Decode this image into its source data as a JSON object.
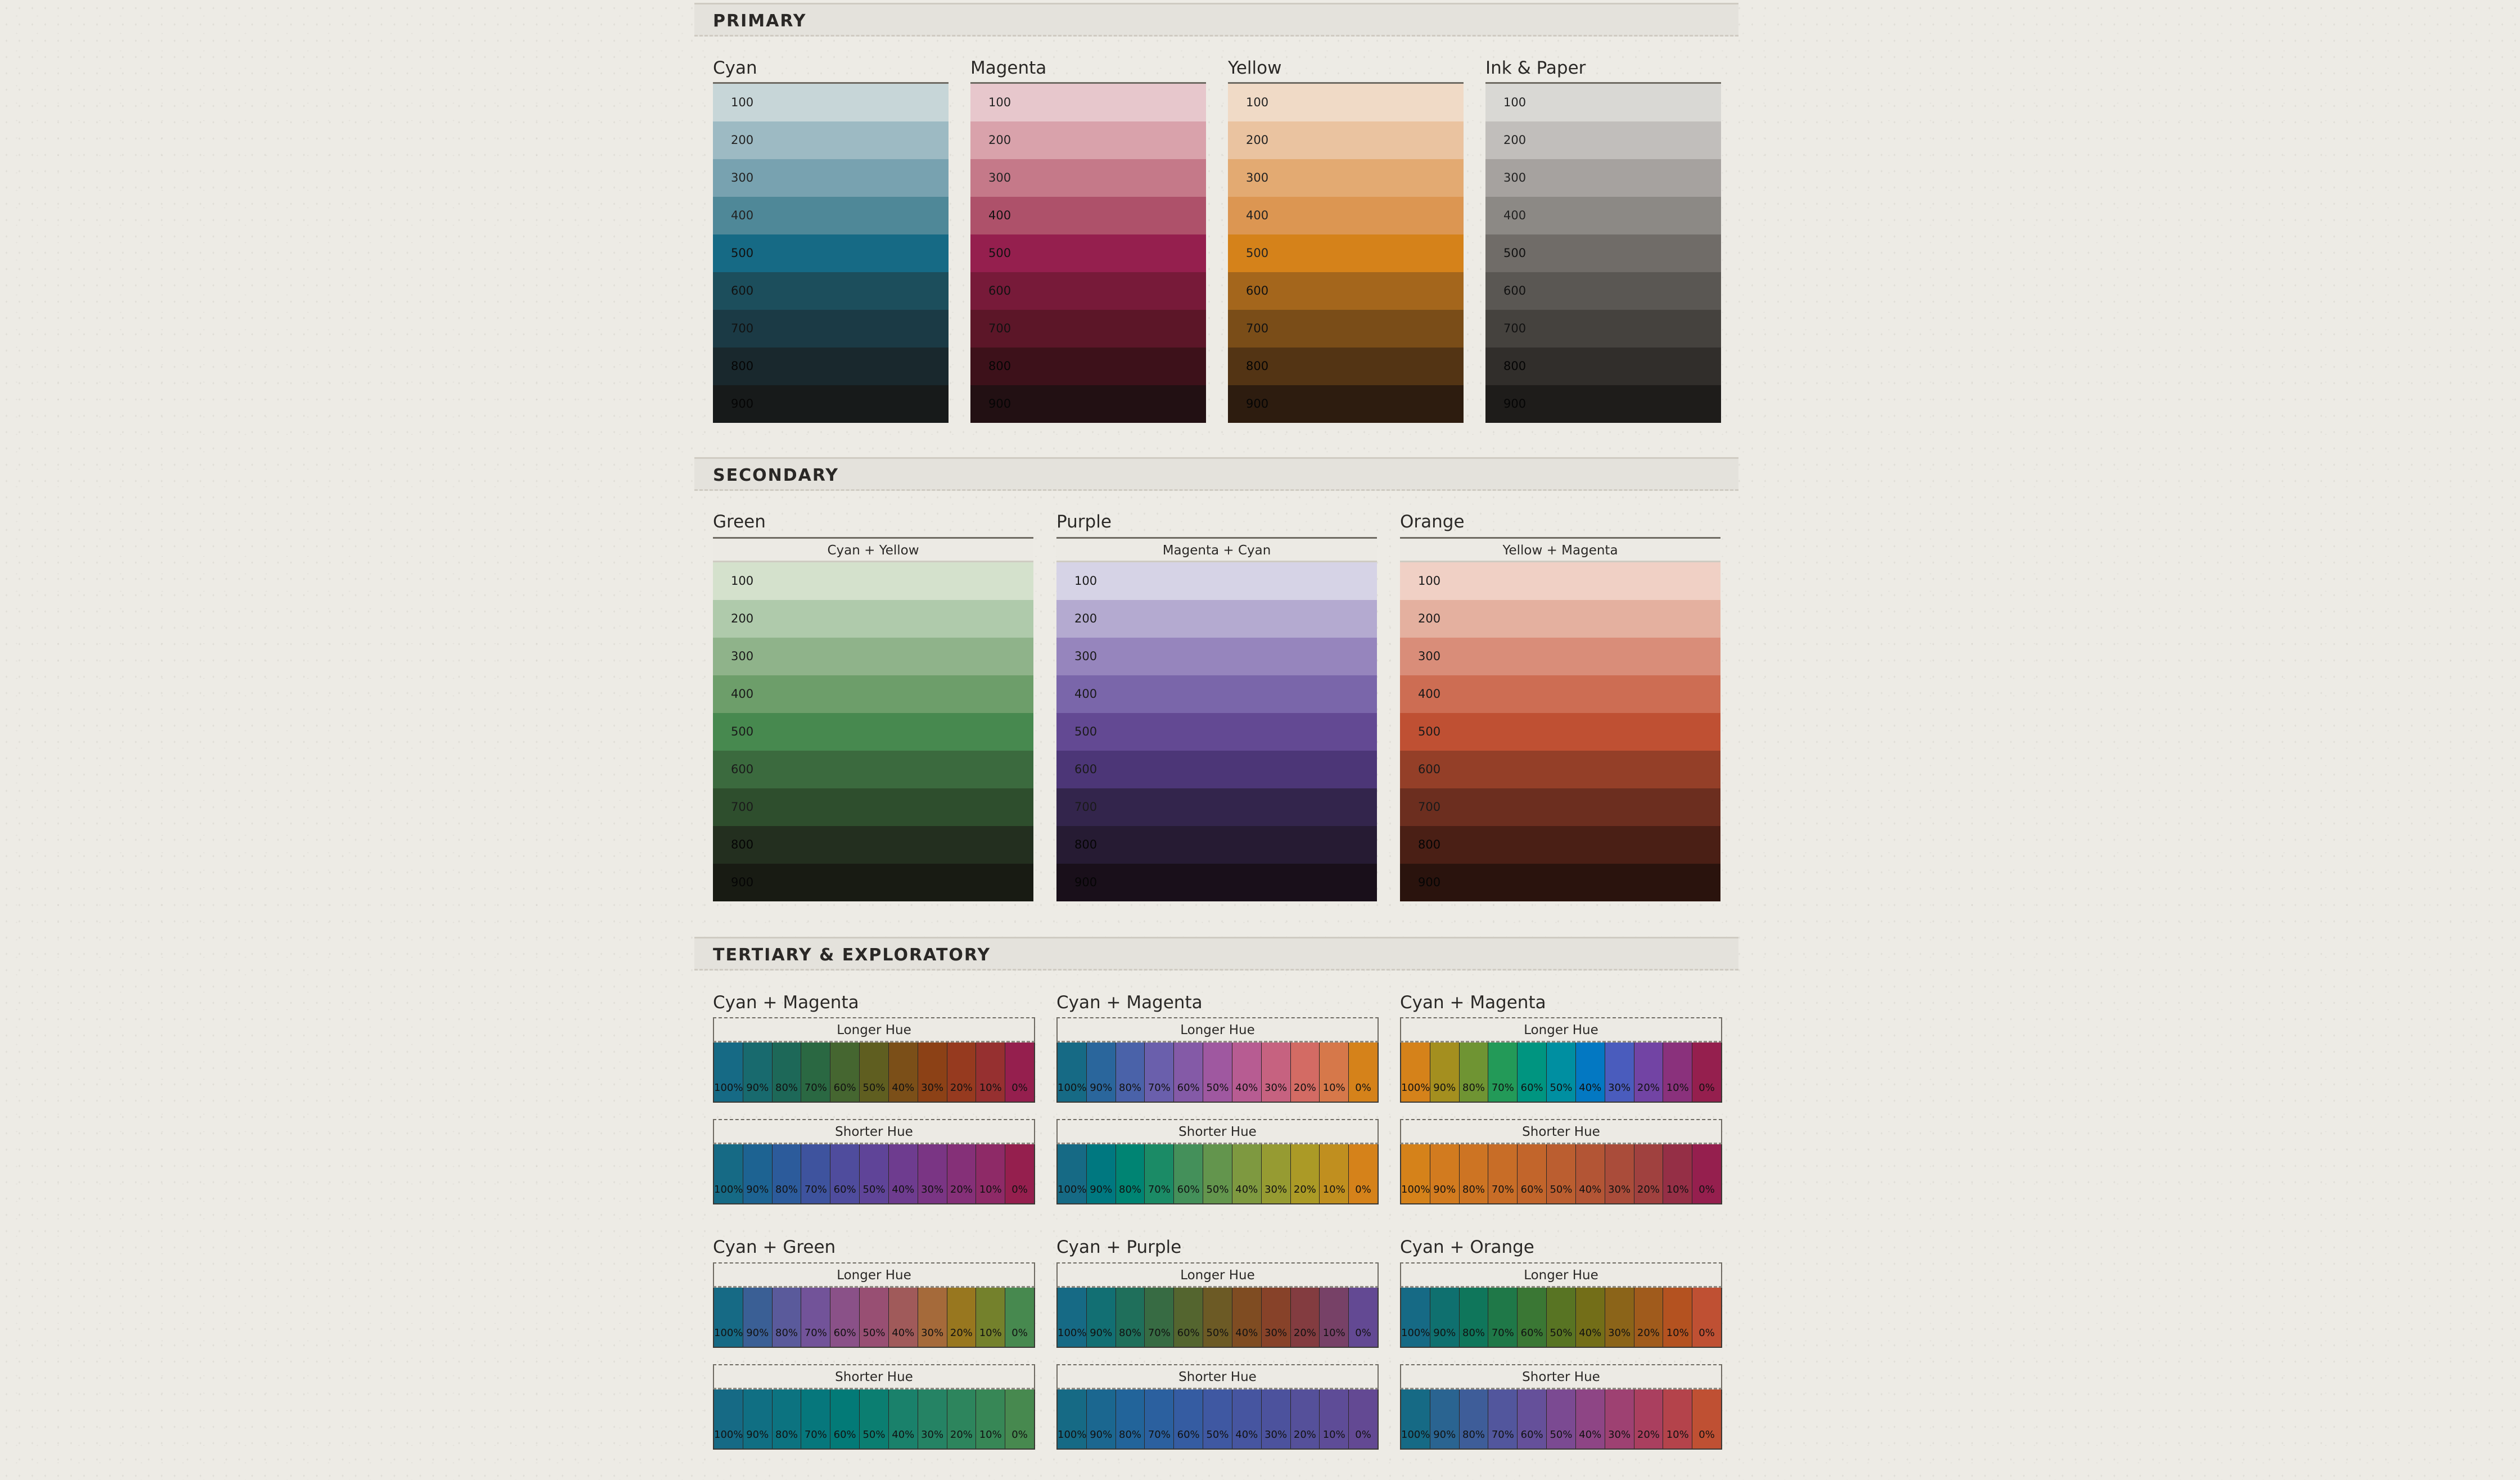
{
  "sections": {
    "primary": "PRIMARY",
    "secondary": "SECONDARY",
    "tertiary": "TERTIARY & EXPLORATORY"
  },
  "steps": [
    "100",
    "200",
    "300",
    "400",
    "500",
    "600",
    "700",
    "800",
    "900"
  ],
  "primary": [
    {
      "name": "Cyan",
      "colors": [
        "#c7d6d8",
        "#9dbac3",
        "#78a2b0",
        "#4f8898",
        "#166a85",
        "#1c4e5c",
        "#1b3a45",
        "#19282d",
        "#171a1a"
      ]
    },
    {
      "name": "Magenta",
      "colors": [
        "#e7c7cc",
        "#d9a2ab",
        "#c57989",
        "#ae516a",
        "#951f4e",
        "#771a39",
        "#5c1628",
        "#3d111a",
        "#221013"
      ]
    },
    {
      "name": "Yellow",
      "colors": [
        "#f0dac6",
        "#eac3a0",
        "#e3aa72",
        "#dc9652",
        "#d5821a",
        "#a4661c",
        "#7a4d18",
        "#533414",
        "#2d1c0f"
      ]
    },
    {
      "name": "Ink & Paper",
      "colors": [
        "#d9d8d4",
        "#c1bebb",
        "#a6a29f",
        "#8c8985",
        "#706c68",
        "#5a5753",
        "#45423e",
        "#312e2b",
        "#1e1c1a"
      ]
    }
  ],
  "secondary": [
    {
      "name": "Green",
      "mix": "Cyan + Yellow",
      "colors": [
        "#d4e1cc",
        "#afcaab",
        "#8fb38a",
        "#6d9e6a",
        "#47894f",
        "#3b6a3e",
        "#2e4e2d",
        "#232f1f",
        "#181b13"
      ]
    },
    {
      "name": "Purple",
      "mix": "Magenta + Cyan",
      "colors": [
        "#d6d3e6",
        "#b4aad0",
        "#9685bd",
        "#7a66aa",
        "#634993",
        "#4c3677",
        "#33254c",
        "#261b33",
        "#190f1a"
      ]
    },
    {
      "name": "Orange",
      "mix": "Yellow + Magenta",
      "colors": [
        "#f0d0c5",
        "#e4b09f",
        "#d98d79",
        "#cd6d53",
        "#bf5033",
        "#943f28",
        "#6c2e1f",
        "#4a1f15",
        "#2a130d"
      ]
    }
  ],
  "tertiary": [
    {
      "name": "Cyan + Magenta",
      "blends": [
        {
          "label": "Longer Hue",
          "colors": [
            "#166a85",
            "#186a6e",
            "#1d6858",
            "#2a6842",
            "#456630",
            "#5f5e20",
            "#7b4f18",
            "#8c4116",
            "#963a1f",
            "#963030",
            "#951f4e"
          ]
        },
        {
          "label": "Shorter Hue",
          "colors": [
            "#166a85",
            "#1d6392",
            "#2c5b9b",
            "#3e539e",
            "#4f4c9d",
            "#5f4498",
            "#6e3c8f",
            "#7a3584",
            "#853078",
            "#8e2a67",
            "#951f4e"
          ]
        }
      ]
    },
    {
      "name": "Cyan + Magenta",
      "blends": [
        {
          "label": "Longer Hue",
          "colors": [
            "#166a85",
            "#2a669c",
            "#4a62a9",
            "#6a5fac",
            "#845aa7",
            "#9f58a0",
            "#b75c92",
            "#c66280",
            "#d36b64",
            "#d6784a",
            "#d5821a"
          ]
        },
        {
          "label": "Shorter Hue",
          "colors": [
            "#166a85",
            "#007880",
            "#008473",
            "#1b8b66",
            "#44905a",
            "#63954d",
            "#7e9940",
            "#969b32",
            "#ab9a26",
            "#c08f1f",
            "#d5821a"
          ]
        }
      ]
    },
    {
      "name": "Cyan + Magenta",
      "blends": [
        {
          "label": "Longer Hue",
          "colors": [
            "#d5821a",
            "#a48f1f",
            "#6f9433",
            "#239a58",
            "#009580",
            "#008fa1",
            "#0378c2",
            "#4a5cbd",
            "#7244a4",
            "#8a317c",
            "#951f4e"
          ]
        },
        {
          "label": "Shorter Hue",
          "colors": [
            "#d5821a",
            "#d27b1f",
            "#cd7423",
            "#c86d27",
            "#c2652b",
            "#bb5e30",
            "#b35535",
            "#aa4c3a",
            "#a0413f",
            "#952f46",
            "#951f4e"
          ]
        }
      ]
    },
    {
      "name": "Cyan + Green",
      "blends": [
        {
          "label": "Longer Hue",
          "colors": [
            "#166a85",
            "#3a5f95",
            "#5a5a9b",
            "#725399",
            "#8a5188",
            "#984f73",
            "#a05a5a",
            "#a56a3a",
            "#98771f",
            "#74812c",
            "#47894f"
          ]
        },
        {
          "label": "Shorter Hue",
          "colors": [
            "#166a85",
            "#106f83",
            "#0c7380",
            "#06777c",
            "#037a77",
            "#0b7e71",
            "#1a816b",
            "#258364",
            "#2d855d",
            "#378756",
            "#47894f"
          ]
        }
      ]
    },
    {
      "name": "Cyan + Purple",
      "blends": [
        {
          "label": "Longer Hue",
          "colors": [
            "#166a85",
            "#126f73",
            "#1f6f5b",
            "#376b43",
            "#54652f",
            "#6c5a25",
            "#7f4c22",
            "#874229",
            "#833c40",
            "#774167",
            "#634993"
          ]
        },
        {
          "label": "Shorter Hue",
          "colors": [
            "#166a85",
            "#1b6790",
            "#22649a",
            "#2b609f",
            "#355ca2",
            "#3f58a2",
            "#4655a0",
            "#4c529d",
            "#55509a",
            "#5e4c97",
            "#634993"
          ]
        }
      ]
    },
    {
      "name": "Cyan + Orange",
      "blends": [
        {
          "label": "Longer Hue",
          "colors": [
            "#166a85",
            "#0f706f",
            "#0f765b",
            "#1f7848",
            "#3a7734",
            "#587423",
            "#736e18",
            "#8b6419",
            "#a05b1c",
            "#b45220",
            "#bf5033"
          ]
        },
        {
          "label": "Shorter Hue",
          "colors": [
            "#166a85",
            "#2a6491",
            "#3e5d99",
            "#52569d",
            "#65509a",
            "#7b4a92",
            "#8e4585",
            "#9e4172",
            "#aa3f5f",
            "#b4434b",
            "#bf5033"
          ]
        }
      ]
    }
  ],
  "percent_labels": [
    "100%",
    "90%",
    "80%",
    "70%",
    "60%",
    "50%",
    "40%",
    "30%",
    "20%",
    "10%",
    "0%"
  ]
}
